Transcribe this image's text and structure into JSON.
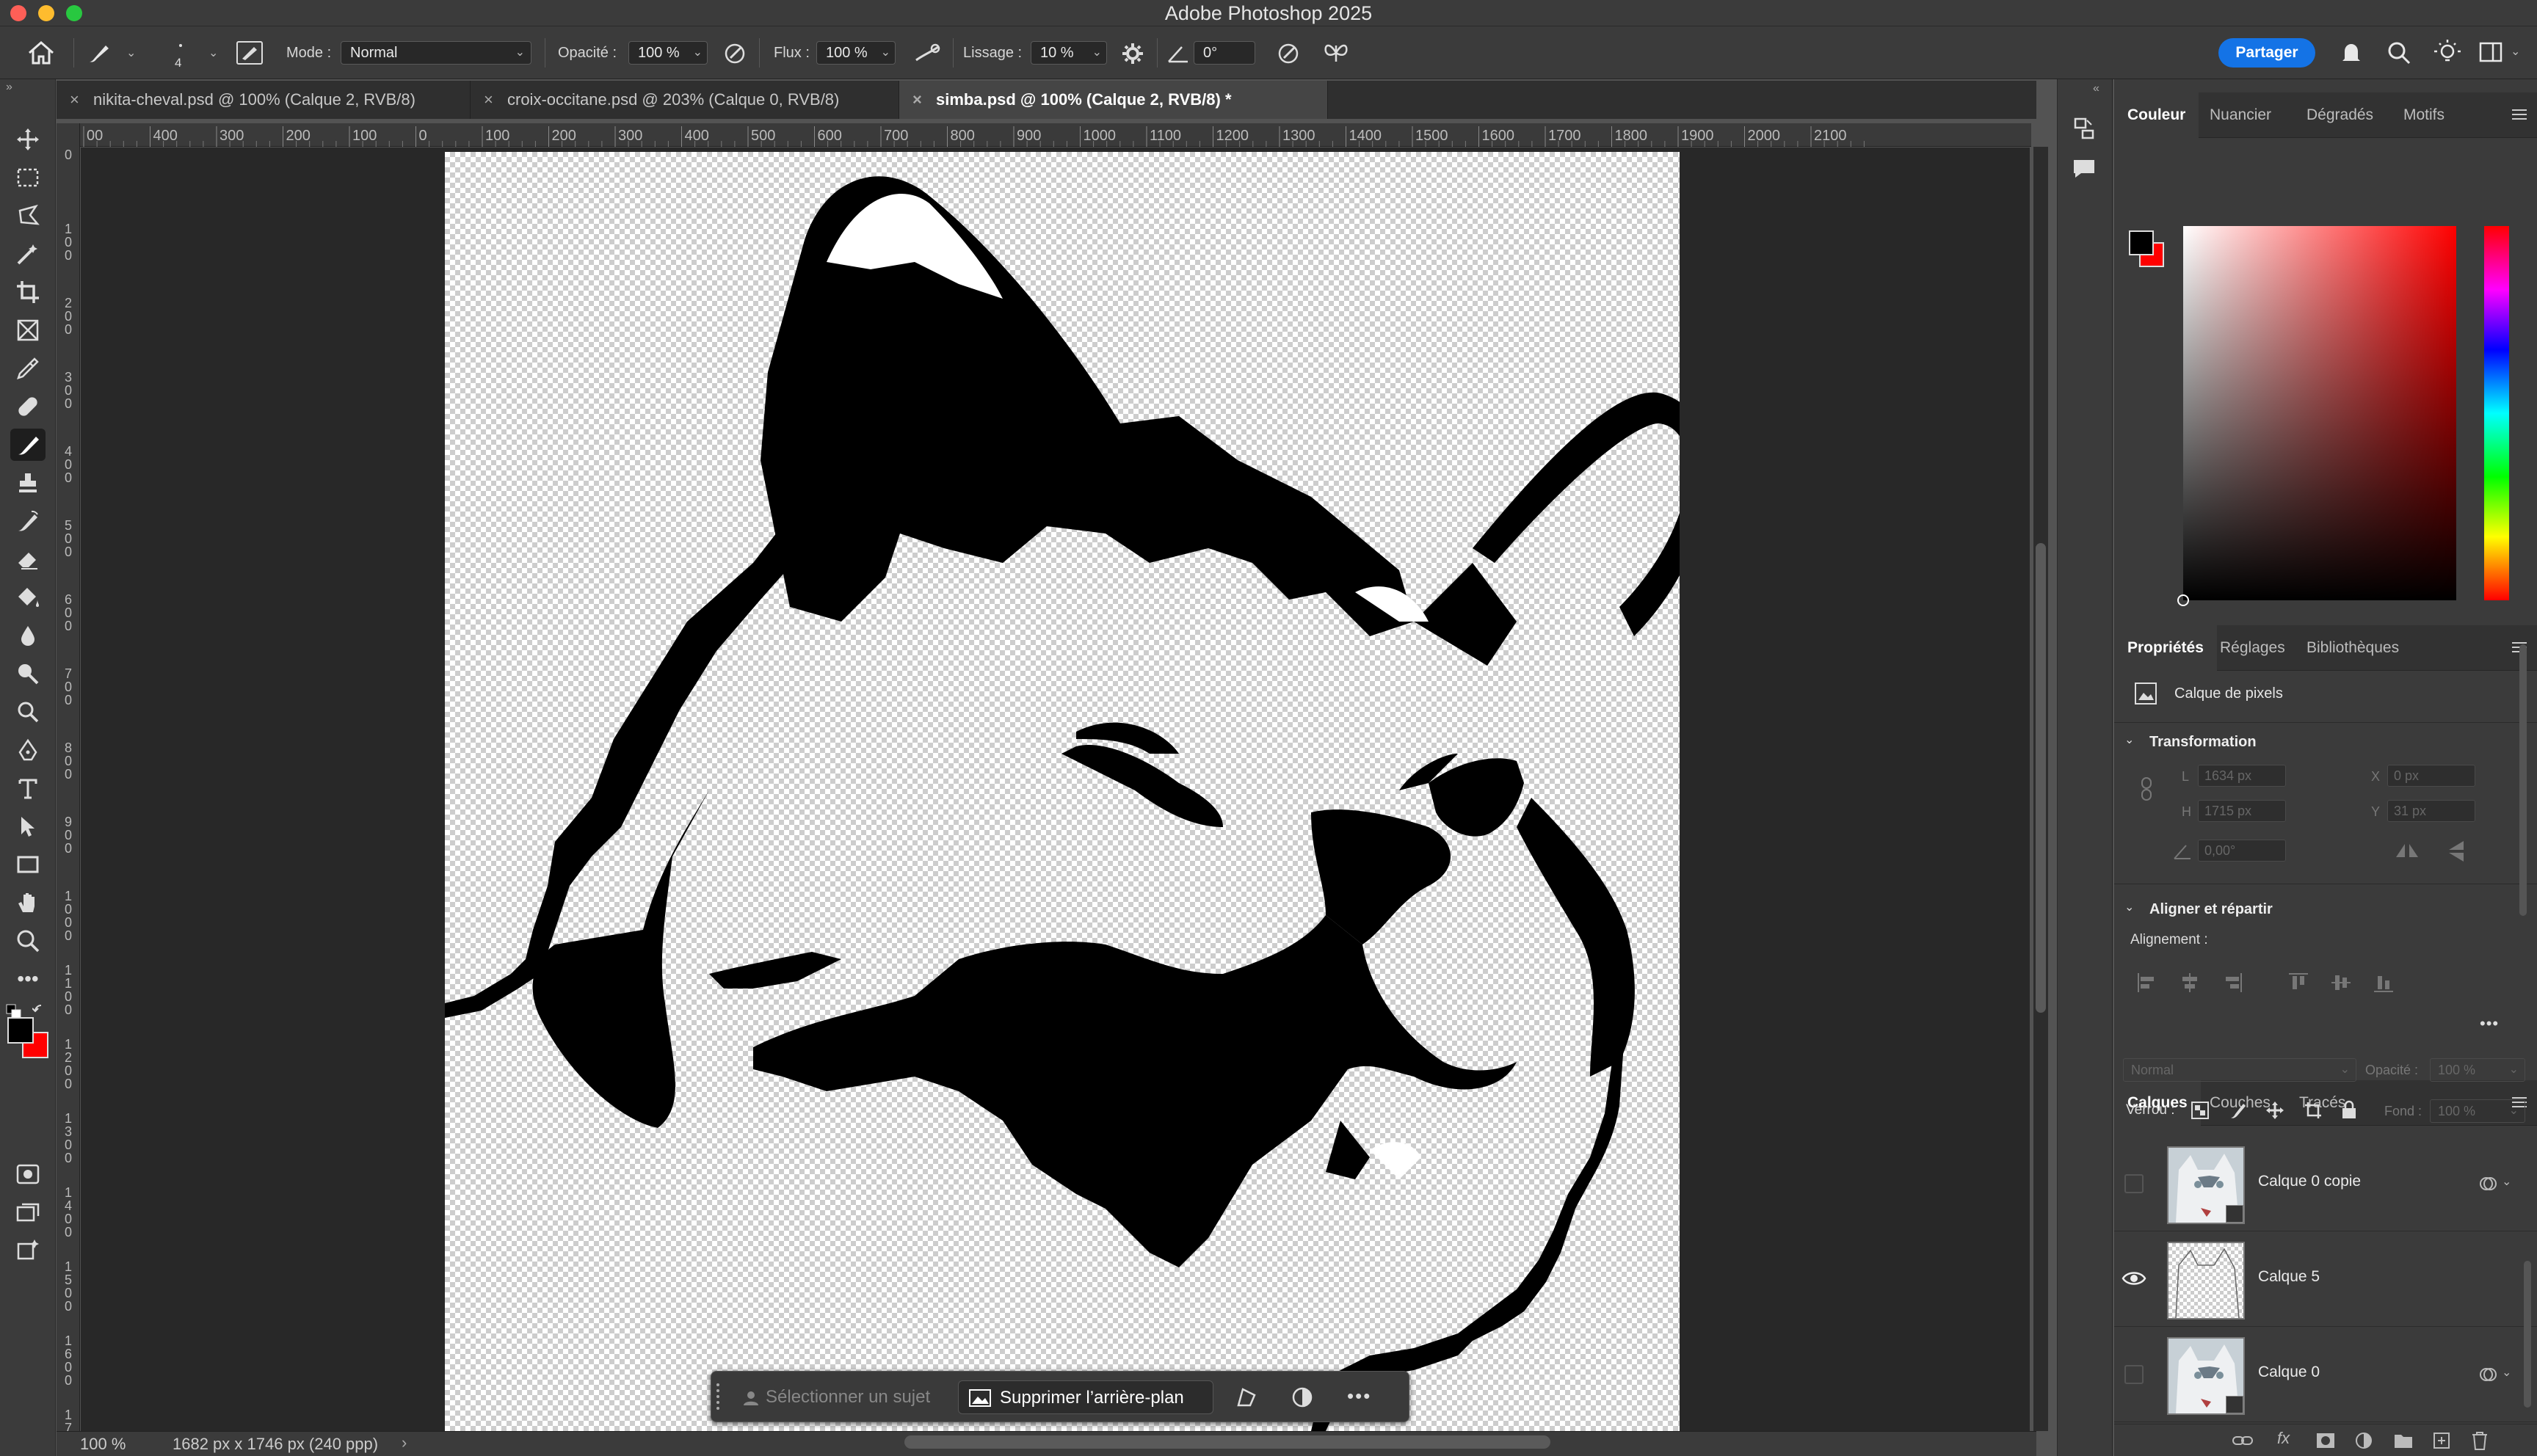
{
  "window": {
    "title": "Adobe Photoshop 2025"
  },
  "options_bar": {
    "brush_size": "4",
    "mode_label": "Mode :",
    "mode_value": "Normal",
    "opacity_label": "Opacité :",
    "opacity_value": "100 %",
    "flow_label": "Flux :",
    "flow_value": "100 %",
    "smoothing_label": "Lissage :",
    "smoothing_value": "10 %",
    "angle_value": "0°",
    "share_label": "Partager"
  },
  "tabs": [
    {
      "label": "nikita-cheval.psd @ 100% (Calque 2, RVB/8)",
      "active": false
    },
    {
      "label": "croix-occitane.psd @ 203% (Calque 0, RVB/8)",
      "active": false
    },
    {
      "label": "simba.psd @ 100% (Calque 2, RVB/8) *",
      "active": true
    }
  ],
  "ruler_h": [
    "00",
    "400",
    "300",
    "200",
    "100",
    "0",
    "100",
    "200",
    "300",
    "400",
    "500",
    "600",
    "700",
    "800",
    "900",
    "1000",
    "1100",
    "1200",
    "1300",
    "1400",
    "1500",
    "1600",
    "1700",
    "1800",
    "1900",
    "2000",
    "2100"
  ],
  "ruler_v": [
    "0",
    "100",
    "200",
    "300",
    "400",
    "500",
    "600",
    "700",
    "800",
    "900",
    "1000",
    "1100",
    "1200",
    "1300",
    "1400",
    "1500",
    "1600",
    "17"
  ],
  "taskbar": {
    "select_subject": "Sélectionner un sujet",
    "remove_background": "Supprimer l’arrière-plan"
  },
  "status": {
    "zoom": "100 %",
    "doc_info": "1682 px x 1746 px (240 ppp)"
  },
  "color_panel": {
    "tabs": [
      "Couleur",
      "Nuancier",
      "Dégradés",
      "Motifs"
    ],
    "active_tab": "Couleur",
    "foreground": "#000000",
    "background": "#ff0000"
  },
  "properties_panel": {
    "tabs": [
      "Propriétés",
      "Réglages",
      "Bibliothèques"
    ],
    "layer_type": "Calque de pixels",
    "transformation_title": "Transformation",
    "w_label": "L",
    "w_value": "1634 px",
    "h_label": "H",
    "h_value": "1715 px",
    "x_label": "X",
    "x_value": "0 px",
    "y_label": "Y",
    "y_value": "31 px",
    "angle_value": "0,00°",
    "align_title": "Aligner et répartir",
    "alignment_label": "Alignement :"
  },
  "layers_panel": {
    "tabs": [
      "Calques",
      "Couches",
      "Tracés"
    ],
    "blend_mode": "Normal",
    "opacity_label": "Opacité :",
    "opacity_value": "100 %",
    "lock_label": "Verrou :",
    "fill_label": "Fond :",
    "fill_value": "100 %",
    "layers": [
      {
        "name": "Calque 0 copie",
        "visible": false
      },
      {
        "name": "Calque 5",
        "visible": true
      },
      {
        "name": "Calque 0",
        "visible": false
      }
    ]
  }
}
